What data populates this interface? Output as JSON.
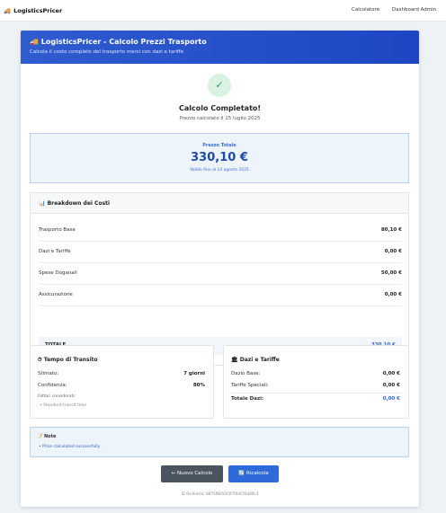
{
  "nav": {
    "brand_icon": "truck-icon",
    "brand": "LogisticsPricer",
    "links": [
      "Calcolatore",
      "Dashboard Admin"
    ]
  },
  "header": {
    "title_icon": "truck-icon",
    "title": "LogisticsPricer - Calcolo Prezzi Trasporto",
    "subtitle": "Calcola il costo completo del trasporto merci con dazi e tariffe"
  },
  "result": {
    "icon": "check-icon",
    "title": "Calcolo Completato!",
    "subtitle": "Prezzo calcolato il 15 luglio 2025"
  },
  "price": {
    "label": "Prezzo Totale",
    "value": "330,10 €",
    "valid_until": "Valido fino al 14 agosto 2025"
  },
  "breakdown": {
    "icon": "bar-chart-icon",
    "title": "Breakdown dei Costi",
    "rows": [
      {
        "label": "Trasporto Base",
        "value": "80,10 €"
      },
      {
        "label": "Dazi e Tariffe",
        "value": "0,00 €"
      },
      {
        "label": "Spese Doganali",
        "value": "50,00 €"
      },
      {
        "label": "Assicurazione",
        "value": "0,00 €"
      }
    ],
    "total_label": "TOTALE",
    "total_value": "330,10 €"
  },
  "transit": {
    "icon": "clock-icon",
    "title": "Tempo di Transito",
    "estimated_label": "Stimato:",
    "estimated_value": "7 giorni",
    "confidence_label": "Confidenza:",
    "confidence_value": "80%",
    "factors_label": "Fattori considerati:",
    "factors": [
      "Standard transit time"
    ]
  },
  "duties": {
    "icon": "bank-icon",
    "title": "Dazi e Tariffe",
    "base_label": "Dazio Base:",
    "base_value": "0,00 €",
    "special_label": "Tariffe Speciali:",
    "special_value": "0,00 €",
    "total_label": "Totale Dazi:",
    "total_value": "0,00 €"
  },
  "notes": {
    "icon": "pencil-icon",
    "title": "Note",
    "items": [
      "Price calculated successfully"
    ]
  },
  "actions": {
    "new_label": "← Nuovo Calcolo",
    "recalc_icon": "refresh-icon",
    "recalc_label": "Ricalcola"
  },
  "request_id": "ID Richiesta: 8875f8650f3f7f4dc54a69c3",
  "colors": {
    "primary": "#2f6bd8",
    "header_bg": "#1e46c4",
    "success": "#2f9e5b",
    "button_dark": "#4a5560"
  }
}
